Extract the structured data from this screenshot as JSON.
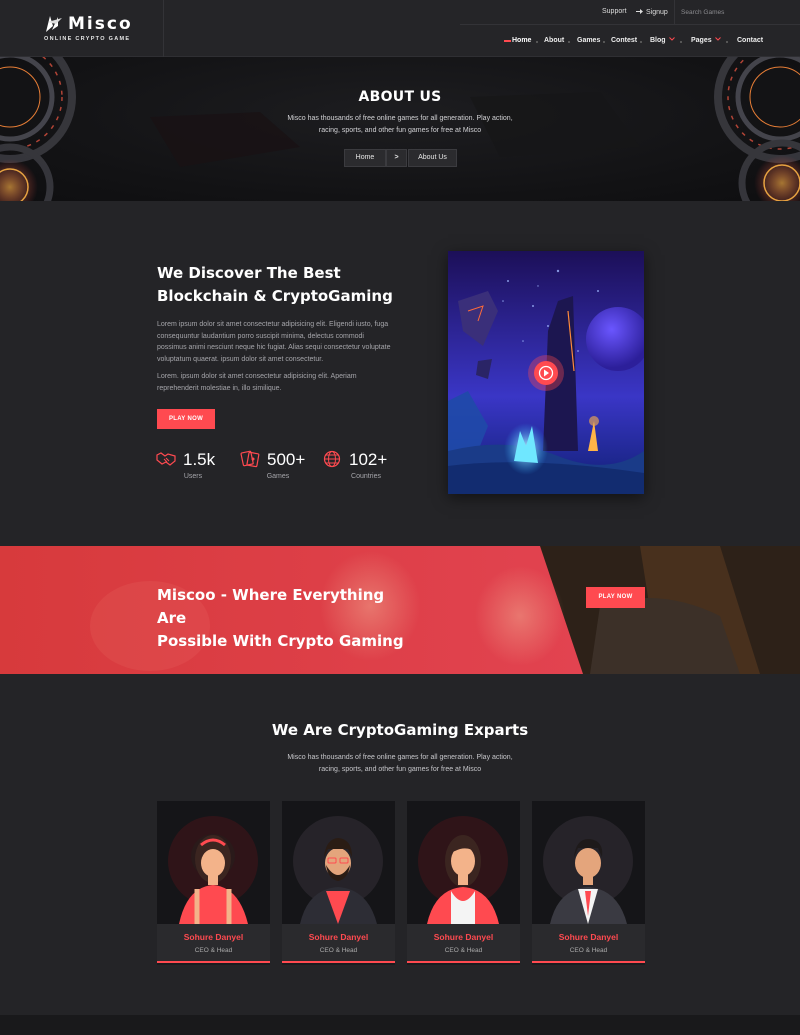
{
  "brand": {
    "name": "Misco",
    "tagline": "ONLINE CRYPTO GAME"
  },
  "topbar": {
    "support_label": "Support",
    "signup_label": "Signup",
    "search_placeholder": "Search Games"
  },
  "nav": {
    "items": [
      {
        "label": "Home",
        "active": true
      },
      {
        "label": "About"
      },
      {
        "label": "Games"
      },
      {
        "label": "Contest"
      },
      {
        "label": "Blog",
        "dropdown": true
      },
      {
        "label": "Pages",
        "dropdown": true
      },
      {
        "label": "Contact"
      }
    ]
  },
  "hero": {
    "title": "ABOUT US",
    "subtitle": "Misco has thousands of free online games for all generation. Play action, racing, sports, and other fun games for free at Misco",
    "breadcrumb": {
      "home": "Home",
      "separator": ">",
      "current": "About Us"
    }
  },
  "about": {
    "title_line1": "We Discover The Best",
    "title_line2": "Blockchain & CryptoGaming",
    "para1": "Lorem ipsum dolor sit amet consectetur adipisicing elit. Eligendi iusto, fuga consequuntur laudantium porro suscipit minima, delectus commodi possimus animi nesciunt neque hic fugiat. Alias sequi consectetur voluptate voluptatum quaerat. ipsum dolor sit amet consectetur.",
    "para2": "Lorem. ipsum dolor sit amet consectetur adipisicing elit. Aperiam reprehenderit molestiae in, illo similique.",
    "button_label": "PLAY NOW",
    "stats": [
      {
        "value": "1.5k",
        "label": "Users",
        "icon": "handshake-icon"
      },
      {
        "value": "500+",
        "label": "Games",
        "icon": "cards-icon"
      },
      {
        "value": "102+",
        "label": "Countries",
        "icon": "globe-icon"
      }
    ]
  },
  "banner": {
    "title_line1": "Miscoo - Where Everything Are",
    "title_line2": "Possible With Crypto Gaming",
    "button_label": "PLAY NOW"
  },
  "team": {
    "title": "We Are CryptoGaming Exparts",
    "subtitle": "Misco has thousands of free online games for all generation. Play action, racing, sports, and other fun games for free at Misco",
    "members": [
      {
        "name": "Sohure Danyel",
        "role": "CEO & Head"
      },
      {
        "name": "Sohure Danyel",
        "role": "CEO & Head"
      },
      {
        "name": "Sohure Danyel",
        "role": "CEO & Head"
      },
      {
        "name": "Sohure Danyel",
        "role": "CEO & Head"
      }
    ]
  },
  "colors": {
    "accent": "#ff4a50",
    "background": "#242427",
    "header": "#252528"
  }
}
